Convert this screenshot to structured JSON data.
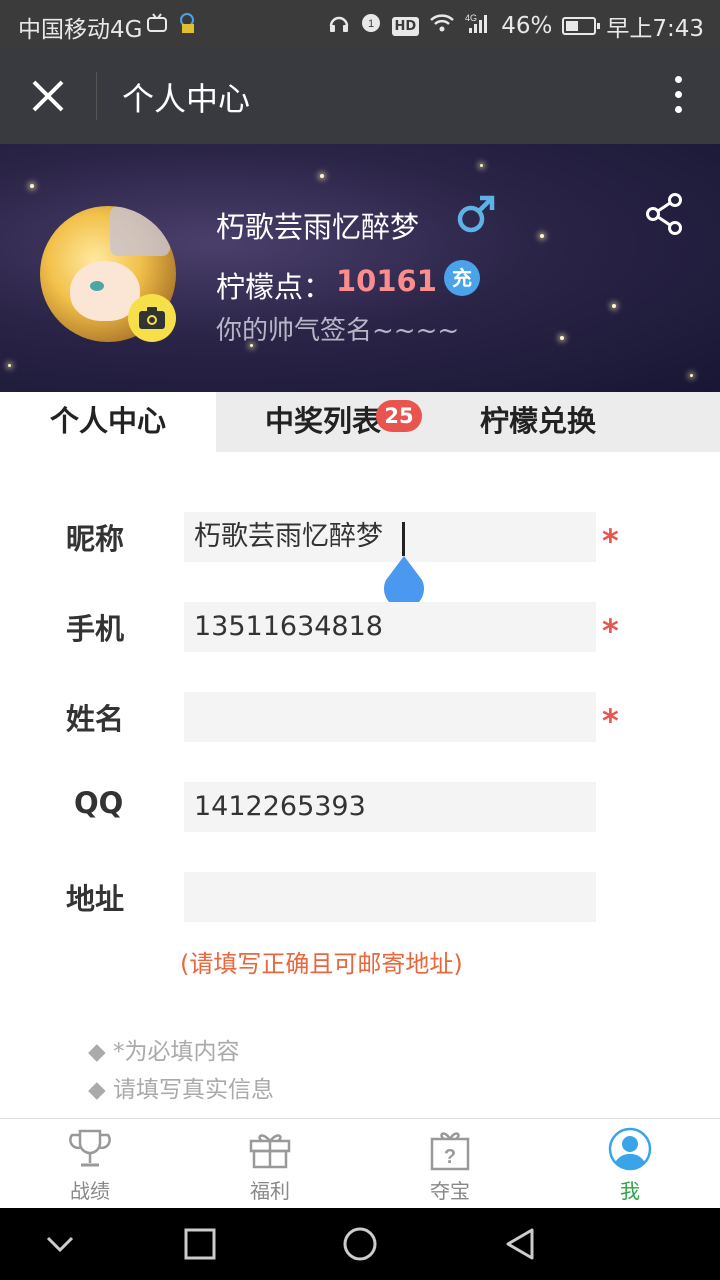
{
  "status_bar": {
    "carrier": "中国移动4G",
    "network": "4G",
    "battery": "46%",
    "time": "早上7:43",
    "battery_level": 0.46
  },
  "title_bar": {
    "title": "个人中心"
  },
  "profile": {
    "username": "朽歌芸雨忆醉梦",
    "gender_symbol": "♂",
    "points_label": "柠檬点：",
    "points_value": "10161",
    "recharge_label": "充",
    "signature": "你的帅气签名~~~~"
  },
  "tabs": [
    {
      "label": "个人中心",
      "active": true
    },
    {
      "label": "中奖列表",
      "badge": "25",
      "active": false
    },
    {
      "label": "柠檬兑换",
      "active": false
    }
  ],
  "form": {
    "nickname": {
      "label": "昵称",
      "value": "朽歌芸雨忆醉梦",
      "required": "*"
    },
    "phone": {
      "label": "手机",
      "value": "13511634818",
      "required": "*"
    },
    "name": {
      "label": "姓名",
      "value": "",
      "required": "*"
    },
    "qq": {
      "label": "QQ",
      "value": "1412265393"
    },
    "address": {
      "label": "地址",
      "value": "",
      "hint": "(请填写正确且可邮寄地址)"
    }
  },
  "notes": [
    "◆ *为必填内容",
    "◆ 请填写真实信息"
  ],
  "bottom_nav": [
    {
      "label": "战绩",
      "icon": "trophy-icon"
    },
    {
      "label": "福利",
      "icon": "gift-icon"
    },
    {
      "label": "夺宝",
      "icon": "mystery-box-icon"
    },
    {
      "label": "我",
      "icon": "user-icon",
      "active": true
    }
  ],
  "colors": {
    "accent_red": "#e8554e",
    "points_pink": "#ff8c8c",
    "active_green": "#2fa44a",
    "user_blue": "#3aa4e8",
    "hint_orange": "#e8673c"
  }
}
